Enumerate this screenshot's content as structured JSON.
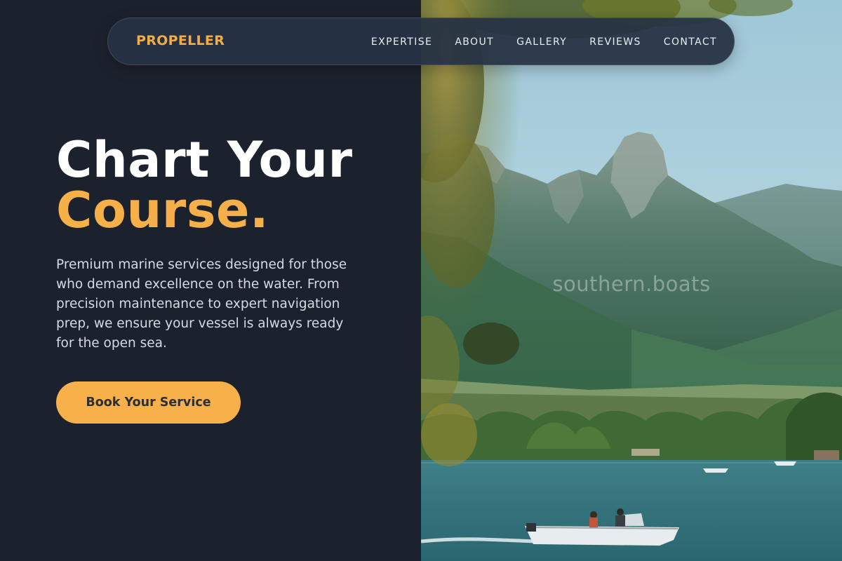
{
  "nav": {
    "brand": "PROPELLER",
    "links": [
      "EXPERTISE",
      "ABOUT",
      "GALLERY",
      "REVIEWS",
      "CONTACT"
    ]
  },
  "hero": {
    "title_line1": "Chart Your",
    "title_line2": "Course.",
    "description": "Premium marine services designed for those who demand excellence on the water. From precision maintenance to expert navigation prep, we ensure your vessel is always ready for the open sea.",
    "cta_label": "Book Your Service"
  },
  "photo": {
    "watermark": "southern.boats"
  },
  "colors": {
    "accent": "#f6b04a",
    "background": "#1c222d",
    "nav_background": "#263244"
  }
}
